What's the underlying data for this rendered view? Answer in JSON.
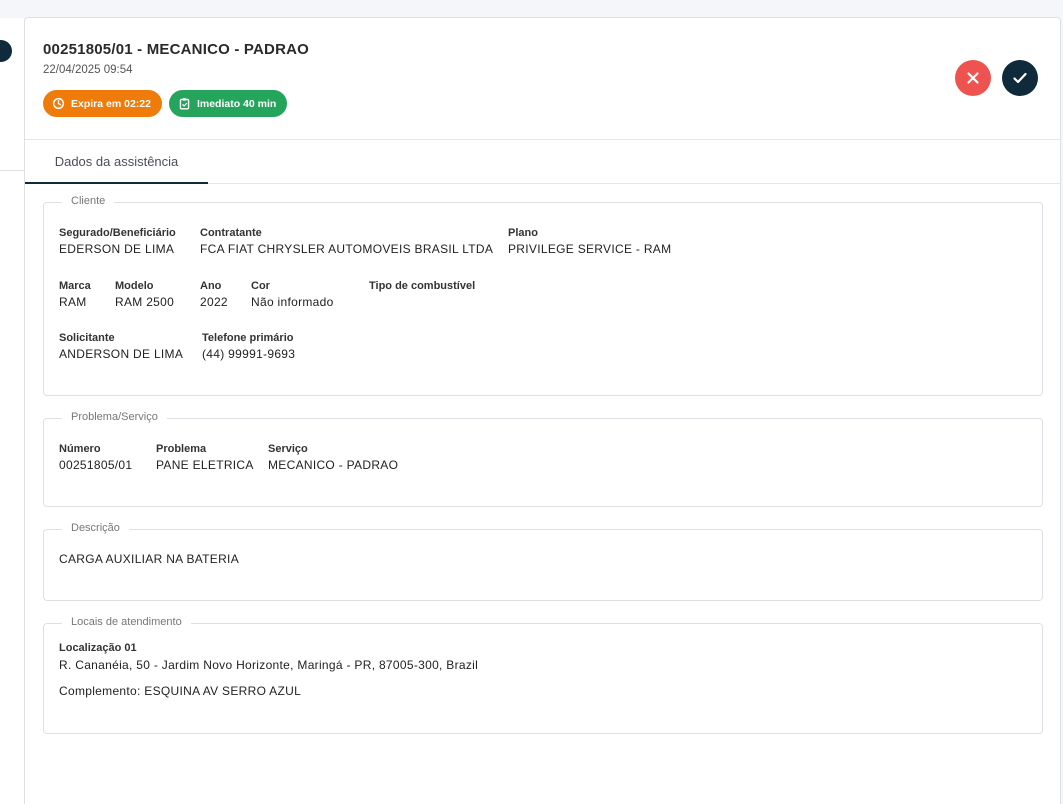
{
  "assistance": {
    "title": "00251805/01 - MECANICO - PADRAO",
    "datetime": "22/04/2025 09:54",
    "badges": {
      "expires": "Expira em 02:22",
      "immediate": "Imediato 40 min"
    },
    "colors": {
      "expires_badge": "#ef7c0a",
      "immediate_badge": "#25a45c",
      "cancel": "#ef5350",
      "confirm": "#0e2a3b"
    },
    "icons": {
      "expires": "clock-icon",
      "immediate": "clipboard-icon",
      "cancel": "close-icon",
      "confirm": "check-icon"
    }
  },
  "tabs": [
    {
      "label": "Dados da assistência",
      "active": true
    }
  ],
  "cliente": {
    "legend": "Cliente",
    "segurado": {
      "label": "Segurado/Beneficiário",
      "value": "EDERSON DE LIMA"
    },
    "contratante": {
      "label": "Contratante",
      "value": "FCA FIAT CHRYSLER AUTOMOVEIS BRASIL LTDA"
    },
    "plano": {
      "label": "Plano",
      "value": "PRIVILEGE SERVICE - RAM"
    },
    "marca": {
      "label": "Marca",
      "value": "RAM"
    },
    "modelo": {
      "label": "Modelo",
      "value": "RAM 2500"
    },
    "ano": {
      "label": "Ano",
      "value": "2022"
    },
    "cor": {
      "label": "Cor",
      "value": "Não informado"
    },
    "combustivel": {
      "label": "Tipo de combustível",
      "value": ""
    },
    "solicitante": {
      "label": "Solicitante",
      "value": "ANDERSON DE LIMA"
    },
    "telefone": {
      "label": "Telefone primário",
      "value": "(44) 99991-9693"
    }
  },
  "problema": {
    "legend": "Problema/Serviço",
    "numero": {
      "label": "Número",
      "value": "00251805/01"
    },
    "problema": {
      "label": "Problema",
      "value": "PANE ELETRICA"
    },
    "servico": {
      "label": "Serviço",
      "value": "MECANICO - PADRAO"
    }
  },
  "descricao": {
    "legend": "Descrição",
    "text": "CARGA AUXILIAR NA BATERIA"
  },
  "locais": {
    "legend": "Locais de atendimento",
    "location_title": "Localização 01",
    "address": "R. Cananéia, 50 - Jardim Novo Horizonte, Maringá - PR, 87005-300, Brazil",
    "complemento": "Complemento: ESQUINA AV SERRO AZUL"
  }
}
